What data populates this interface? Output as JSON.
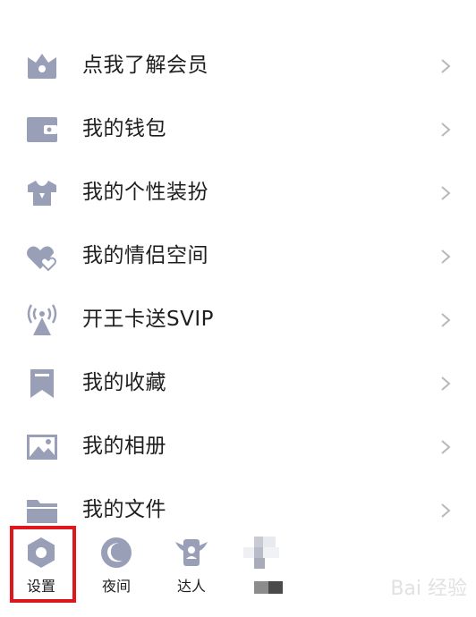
{
  "menu": {
    "items": [
      {
        "label": "点我了解会员",
        "icon": "crown-basket-icon"
      },
      {
        "label": "我的钱包",
        "icon": "wallet-icon"
      },
      {
        "label": "我的个性装扮",
        "icon": "tshirt-icon"
      },
      {
        "label": "我的情侣空间",
        "icon": "hearts-icon"
      },
      {
        "label": "开王卡送SVIP",
        "icon": "signal-tower-icon"
      },
      {
        "label": "我的收藏",
        "icon": "bookmark-icon"
      },
      {
        "label": "我的相册",
        "icon": "photo-icon"
      },
      {
        "label": "我的文件",
        "icon": "folder-icon"
      }
    ]
  },
  "bottom_bar": {
    "settings_label": "设置",
    "night_label": "夜间",
    "daren_label": "达人"
  },
  "watermark": {
    "text": "Bai 经验"
  },
  "colors": {
    "icon": "#9a9fb8",
    "text": "#1e1e1e",
    "chevron": "#b8b8b8",
    "highlight": "#e0181e",
    "background": "#ffffff"
  }
}
